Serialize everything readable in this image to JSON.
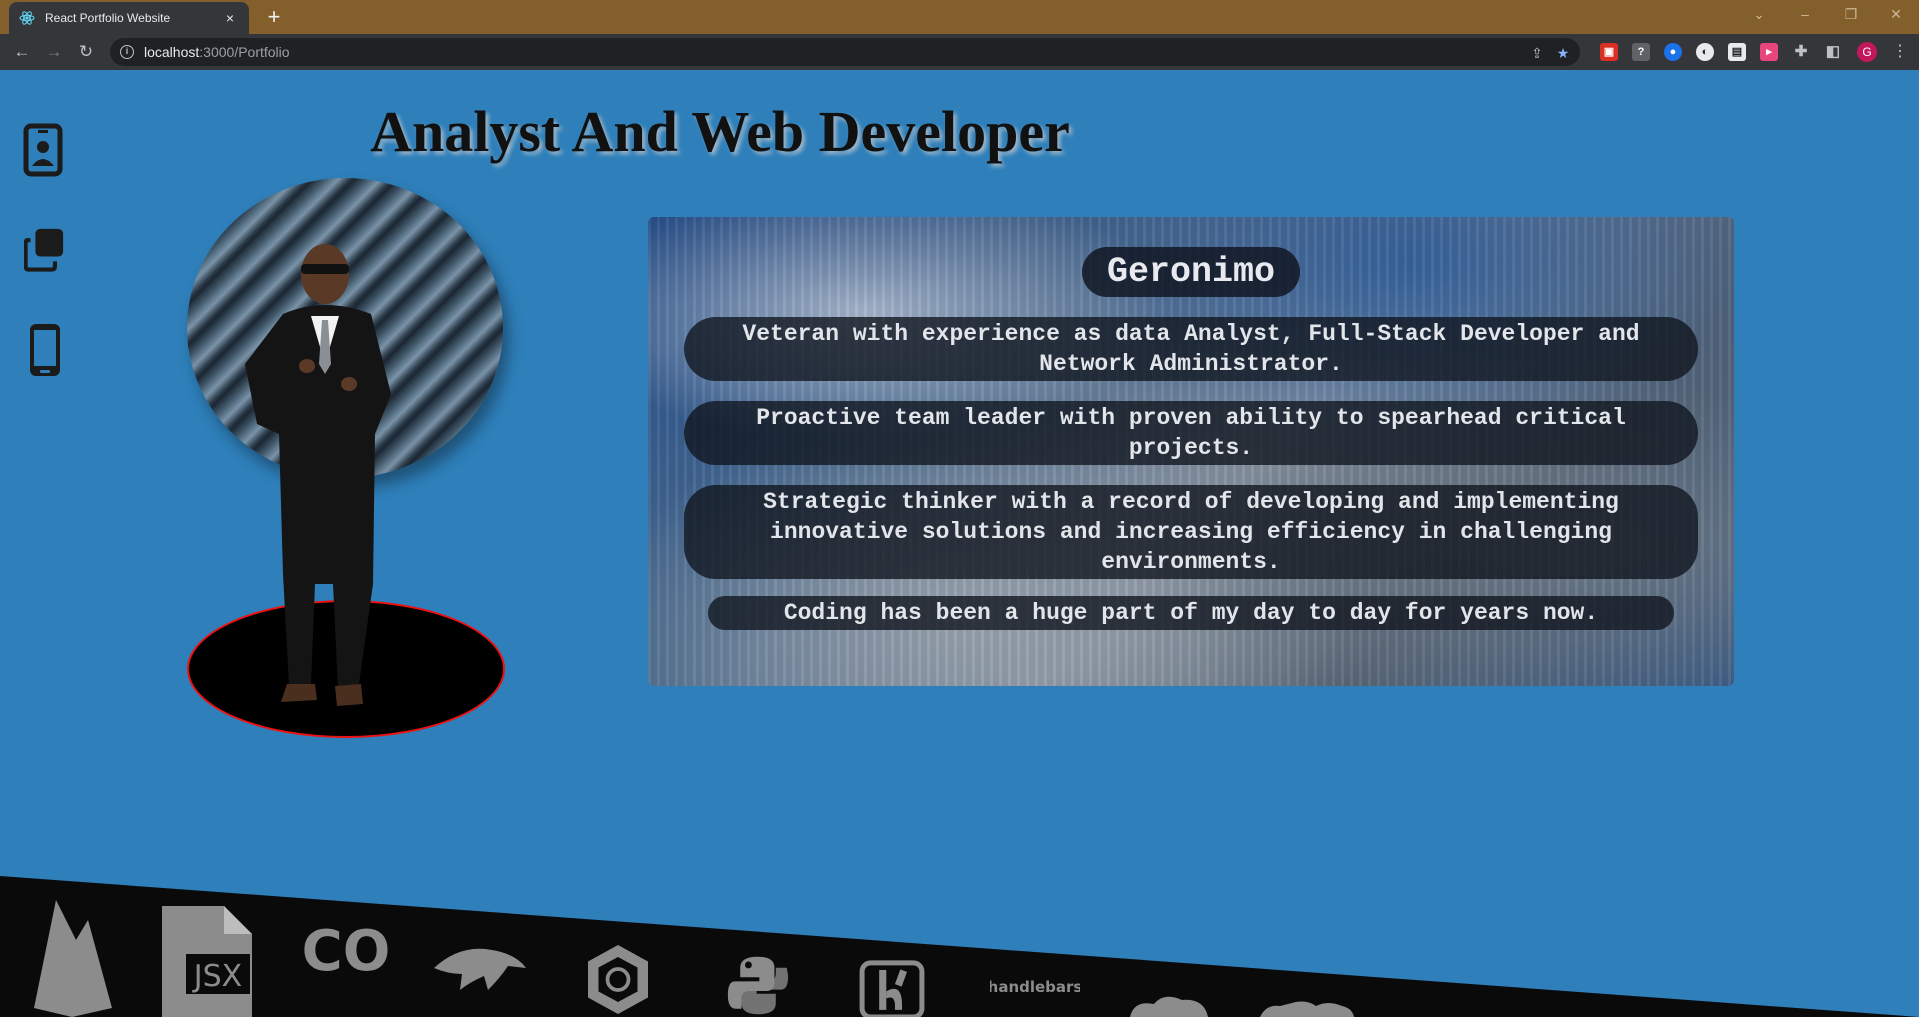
{
  "browser": {
    "tab_title": "React Portfolio Website",
    "tab_close": "×",
    "new_tab": "+",
    "url_host": "localhost",
    "url_rest": ":3000/Portfolio",
    "profile_initial": "G",
    "window_controls": [
      "⌄",
      "–",
      "❐",
      "✕"
    ]
  },
  "page": {
    "title": "Analyst And Web Developer",
    "sidenav": [
      {
        "icon": "contact-card-icon"
      },
      {
        "icon": "portfolio-copy-icon"
      },
      {
        "icon": "mobile-phone-icon"
      }
    ]
  },
  "card": {
    "name": "Geronimo",
    "lines": [
      "Veteran with experience as data Analyst, Full-Stack Developer and Network Administrator.",
      "Proactive team leader with proven ability to spearhead critical projects.",
      "Strategic thinker with a record of developing and implementing innovative solutions and increasing efficiency in challenging environments.",
      "Coding has been a huge part of my day to day for years now."
    ]
  },
  "skills": {
    "icons": [
      "firebase-icon",
      "jsx-file-icon",
      "coffeescript-icon",
      "mysql-dolphin-icon",
      "graphql-hex-icon",
      "python-icon",
      "bootstrap-icon",
      "handlebars-icon",
      "cloud-icon",
      "heroku-icon"
    ],
    "jsx_label": "JSX",
    "co_label": "CO",
    "handlebars_label": "handlebars"
  },
  "colors": {
    "page_bg": "#2e7fba",
    "titlebar": "#835f2b",
    "chrome_dark": "#35363a",
    "base_ring": "#ee1111"
  }
}
